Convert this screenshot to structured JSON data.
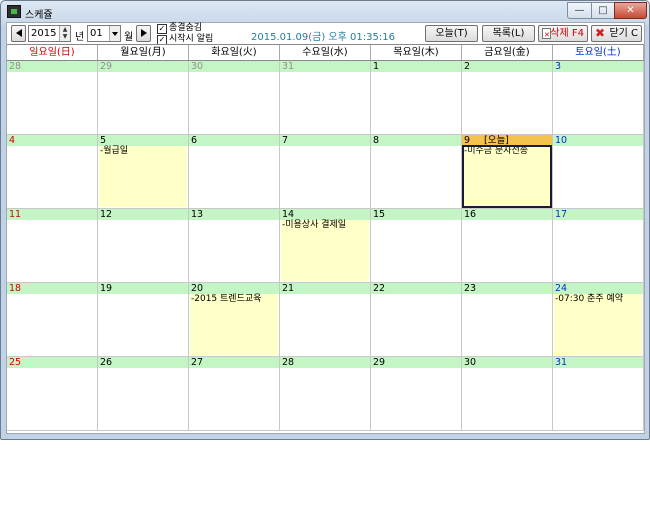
{
  "window": {
    "title": "스케쥴"
  },
  "toolbar": {
    "year": "2015",
    "year_unit": "년",
    "month": "01",
    "month_unit": "월",
    "chk_lunar": "종결숨김",
    "chk_alarm": "시작시 알림",
    "datetime": "2015.01.09(금) 오후 01:35:16",
    "today_label": "오늘(T)",
    "list_label": "목록(L)",
    "delete_label": "삭제 F4",
    "close_label": "닫기 C"
  },
  "colors": {
    "header_green": "#c4f5c4",
    "today_orange": "#f5c24e",
    "event_yellow": "#ffffc8",
    "sunday_red": "#d00000",
    "saturday_blue": "#0030d0",
    "datetime_teal": "#1f7ea0"
  },
  "weekdays": [
    "일요일(日)",
    "월요일(月)",
    "화요일(火)",
    "수요일(水)",
    "목요일(木)",
    "금요일(金)",
    "토요일(土)"
  ],
  "weeks": [
    [
      {
        "num": "28",
        "other": true
      },
      {
        "num": "29",
        "other": true
      },
      {
        "num": "30",
        "other": true
      },
      {
        "num": "31",
        "other": true
      },
      {
        "num": "1"
      },
      {
        "num": "2"
      },
      {
        "num": "3"
      }
    ],
    [
      {
        "num": "4"
      },
      {
        "num": "5",
        "event": "-월급일"
      },
      {
        "num": "6"
      },
      {
        "num": "7"
      },
      {
        "num": "8"
      },
      {
        "num": "9",
        "today": "[오늘]",
        "event": "-미수금 문자전송",
        "selected": true
      },
      {
        "num": "10"
      }
    ],
    [
      {
        "num": "11"
      },
      {
        "num": "12"
      },
      {
        "num": "13"
      },
      {
        "num": "14",
        "event": "-미용상사 결제일"
      },
      {
        "num": "15"
      },
      {
        "num": "16"
      },
      {
        "num": "17"
      }
    ],
    [
      {
        "num": "18"
      },
      {
        "num": "19"
      },
      {
        "num": "20",
        "event": "-2015 트렌드교육"
      },
      {
        "num": "21"
      },
      {
        "num": "22"
      },
      {
        "num": "23"
      },
      {
        "num": "24",
        "event": "-07:30 춘주 예약"
      }
    ],
    [
      {
        "num": "25"
      },
      {
        "num": "26"
      },
      {
        "num": "27"
      },
      {
        "num": "28"
      },
      {
        "num": "29"
      },
      {
        "num": "30"
      },
      {
        "num": "31"
      }
    ]
  ]
}
